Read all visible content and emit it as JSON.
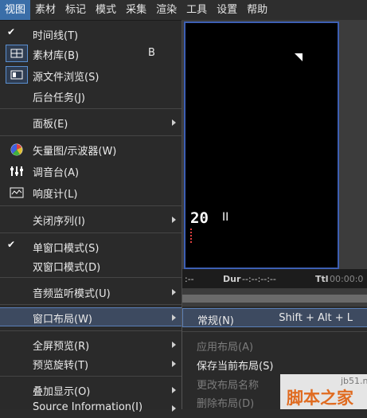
{
  "menubar": [
    "视图",
    "素材",
    "标记",
    "模式",
    "采集",
    "渲染",
    "工具",
    "设置",
    "帮助"
  ],
  "timecode": {
    "tc": "20",
    "marker": "II",
    "left": ":--",
    "dur_label": "Dur",
    "dur_value": "--:--:--:--",
    "ttl_label": "Ttl",
    "ttl_value": "00:00:0"
  },
  "menu": {
    "timeline": "时间线(T)",
    "bin": "素材库(B)",
    "bin_shortcut": "B",
    "source_browser": "源文件浏览(S)",
    "background_tasks": "后台任务(J)",
    "panels": "面板(E)",
    "vectorscope": "矢量图/示波器(W)",
    "audio_mixer": "调音台(A)",
    "loudness_meter": "响度计(L)",
    "close_sequence": "关闭序列(I)",
    "single_window": "单窗口模式(S)",
    "dual_window": "双窗口模式(D)",
    "audio_monitor": "音频监听模式(U)",
    "window_layout": "窗口布局(W)",
    "fullscreen_preview": "全屏预览(R)",
    "preview_rotate": "预览旋转(T)",
    "overlay_display": "叠加显示(O)",
    "source_information": "Source Information(I)"
  },
  "submenu": {
    "normal": "常规(N)",
    "normal_shortcut": "Shift + Alt + L",
    "apply_layout": "应用布局(A)",
    "save_current": "保存当前布局(S)",
    "rename_layout": "更改布局名称",
    "delete_layout": "删除布局(D)"
  },
  "watermark": {
    "site": "jb51.net",
    "name": "脚本之家"
  }
}
